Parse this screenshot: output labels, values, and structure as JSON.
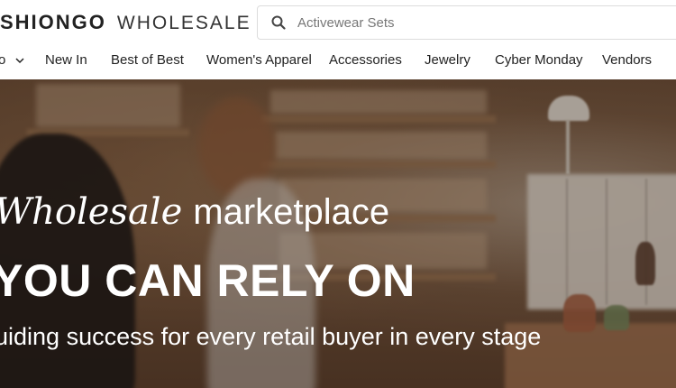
{
  "brand": {
    "name": "SHIONGO",
    "sub": "WHOLESALE"
  },
  "search": {
    "placeholder": "Activewear Sets"
  },
  "nav": {
    "items": [
      {
        "label": "o"
      },
      {
        "label": "New In"
      },
      {
        "label": "Best of Best"
      },
      {
        "label": "Women's Apparel"
      },
      {
        "label": "Accessories"
      },
      {
        "label": "Jewelry"
      },
      {
        "label": "Cyber Monday"
      },
      {
        "label": "Vendors"
      }
    ]
  },
  "hero": {
    "line1_italic": "Wholesale",
    "line1_rest": "marketplace",
    "line2": "YOU CAN RELY ON",
    "line3": "uiding success for every retail buyer in every stage"
  },
  "colors": {
    "text_dark": "#222222",
    "hero_text": "#ffffff",
    "border": "#dcdcdc"
  }
}
